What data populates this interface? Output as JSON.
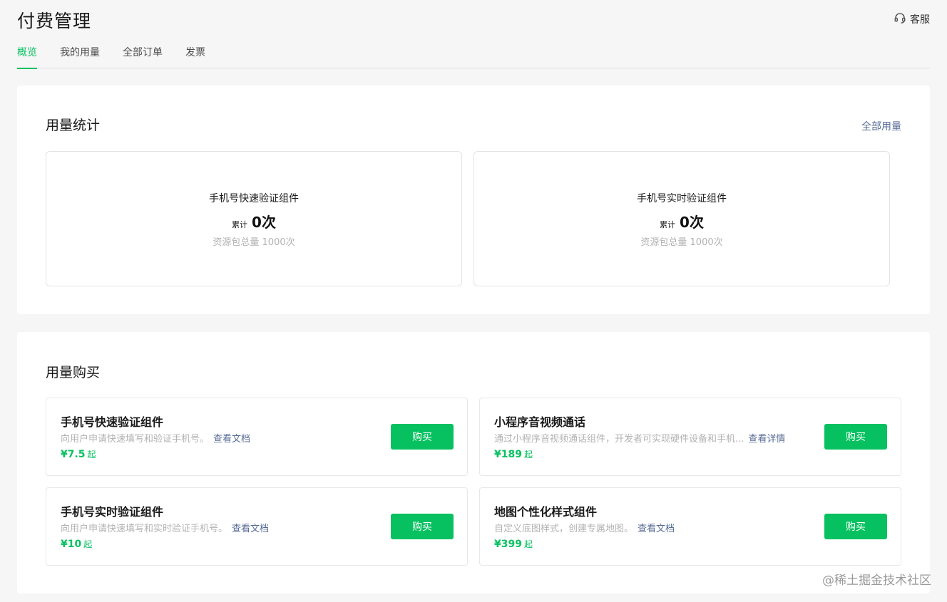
{
  "header": {
    "title": "付费管理",
    "customer_service": "客服"
  },
  "tabs": [
    {
      "label": "概览",
      "active": true
    },
    {
      "label": "我的用量",
      "active": false
    },
    {
      "label": "全部订单",
      "active": false
    },
    {
      "label": "发票",
      "active": false
    }
  ],
  "usage": {
    "title": "用量统计",
    "all_link": "全部用量",
    "cards": [
      {
        "name": "手机号快速验证组件",
        "total_label": "累计",
        "total_value": "0次",
        "quota": "资源包总量 1000次"
      },
      {
        "name": "手机号实时验证组件",
        "total_label": "累计",
        "total_value": "0次",
        "quota": "资源包总量 1000次"
      }
    ]
  },
  "purchase": {
    "title": "用量购买",
    "buy_label": "购买",
    "products": [
      {
        "name": "手机号快速验证组件",
        "desc": "向用户申请快速填写和验证手机号。",
        "link": "查看文档",
        "price": "¥7.5",
        "unit": "起"
      },
      {
        "name": "小程序音视频通话",
        "desc": "通过小程序音视频通话组件，开发者可实现硬件设备和手机...",
        "link": "查看详情",
        "price": "¥189",
        "unit": "起"
      },
      {
        "name": "手机号实时验证组件",
        "desc": "向用户申请快速填写和实时验证手机号。",
        "link": "查看文档",
        "price": "¥10",
        "unit": "起"
      },
      {
        "name": "地图个性化样式组件",
        "desc": "自定义底图样式，创建专属地图。",
        "link": "查看文档",
        "price": "¥399",
        "unit": "起"
      }
    ]
  },
  "watermark": "@稀土掘金技术社区",
  "colors": {
    "accent": "#07c160",
    "link": "#576b95"
  }
}
